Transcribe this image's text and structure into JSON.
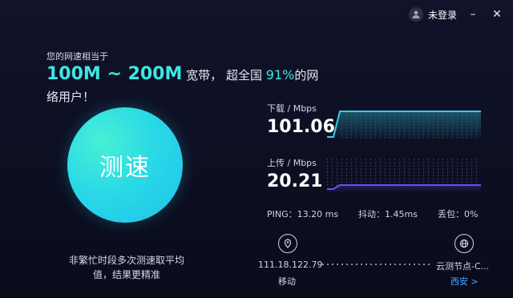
{
  "header": {
    "username": "未登录",
    "minimize_icon": "minimize-icon",
    "close_icon": "close-icon"
  },
  "left": {
    "intro": "您的网速相当于",
    "speed_range": "100M ~ 200M",
    "broadband_text": "宽带，",
    "exceed_text": "超全国",
    "percent": "91%",
    "tail_text": "的网",
    "tail_line2": "络用户！",
    "test_button": "测速",
    "tip_line1": "非繁忙时段多次测速取平均",
    "tip_line2": "值，结果更精准"
  },
  "right": {
    "download_label": "下载 / Mbps",
    "download_value": "101.06",
    "upload_label": "上传 / Mbps",
    "upload_value": "20.21",
    "ping": "PING：13.20 ms",
    "jitter": "抖动：1.45ms",
    "loss": "丢包：0%",
    "ip": "111.18.122.79",
    "isp": "移动",
    "node": "云测节点-C...",
    "node_city": "西安 >"
  },
  "colors": {
    "accent": "#3fe6e0",
    "download_line": "#35d0e6",
    "upload_line": "#6a4dff",
    "background": "#0b0d1f"
  }
}
